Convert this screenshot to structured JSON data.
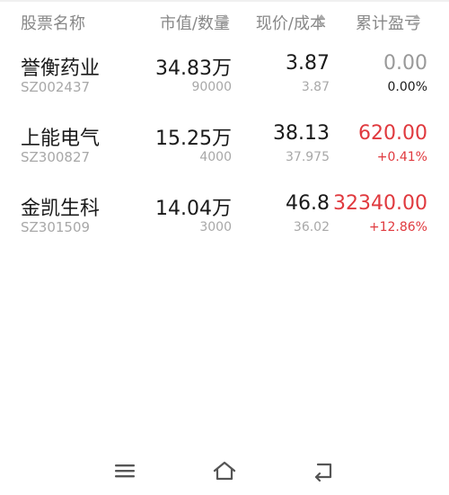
{
  "header": {
    "name_col": "股票名称",
    "value_col": "市值/数量",
    "price_col": "现价/成本",
    "profit_col": "累计盈亏"
  },
  "holdings": [
    {
      "name": "誉衡药业",
      "code": "SZ002437",
      "market_value": "34.83万",
      "quantity": "90000",
      "current_price": "3.87",
      "cost_price": "3.87",
      "profit": "0.00",
      "profit_pct": "0.00%",
      "trend": "neutral"
    },
    {
      "name": "上能电气",
      "code": "SZ300827",
      "market_value": "15.25万",
      "quantity": "4000",
      "current_price": "38.13",
      "cost_price": "37.975",
      "profit": "620.00",
      "profit_pct": "+0.41%",
      "trend": "up"
    },
    {
      "name": "金凯生科",
      "code": "SZ301509",
      "market_value": "14.04万",
      "quantity": "3000",
      "current_price": "46.8",
      "cost_price": "36.02",
      "profit": "32340.00",
      "profit_pct": "+12.86%",
      "trend": "up"
    }
  ],
  "colors": {
    "up": "#e0393e",
    "neutral": "#999999",
    "header_text": "#888888",
    "primary_text": "#1a1a1a",
    "secondary_text": "#a8a8a8"
  },
  "navbar": {
    "menu_icon": "menu-icon",
    "home_icon": "home-icon",
    "back_icon": "back-icon"
  }
}
